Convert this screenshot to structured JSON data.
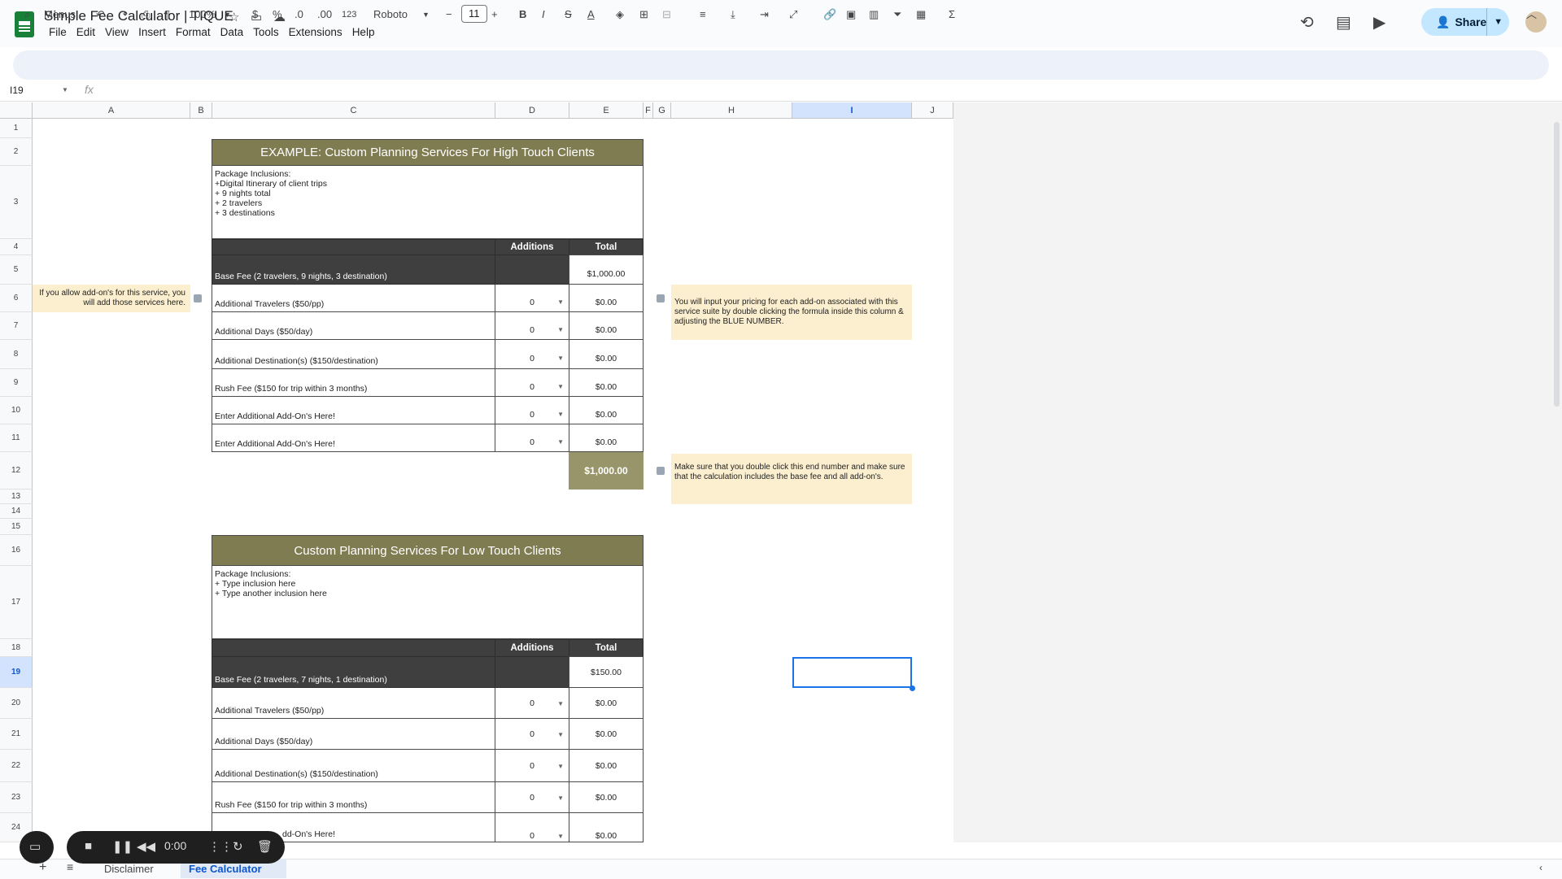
{
  "app": {
    "title": "Simple Fee Calculator | TIQUE",
    "menu": [
      "File",
      "Edit",
      "View",
      "Insert",
      "Format",
      "Data",
      "Tools",
      "Extensions",
      "Help"
    ],
    "share_label": "Share"
  },
  "toolbar": {
    "menus_label": "Menus",
    "zoom": "100%",
    "currency": "$",
    "percent": "%",
    "dec_dec": ".0",
    "inc_dec": ".00",
    "num_fmt": "123",
    "font": "Roboto",
    "font_size": "11",
    "bold": "B",
    "italic": "I",
    "strike": "S",
    "textcolor": "A",
    "sum": "Σ"
  },
  "formula_bar": {
    "cell_ref": "I19",
    "fx": "fx"
  },
  "columns": [
    "A",
    "B",
    "C",
    "D",
    "E",
    "F",
    "G",
    "H",
    "I",
    "J"
  ],
  "rows": [
    "1",
    "2",
    "3",
    "4",
    "5",
    "6",
    "7",
    "8",
    "9",
    "10",
    "11",
    "12",
    "13",
    "14",
    "15",
    "16",
    "17",
    "18",
    "19",
    "20",
    "21",
    "22",
    "23",
    "24"
  ],
  "table1": {
    "title": "EXAMPLE: Custom Planning Services For High Touch Clients",
    "inclusions": [
      "Package Inclusions:",
      "+Digital Itinerary of client trips",
      "+ 9 nights total",
      "+ 2 travelers",
      "+ 3 destinations"
    ],
    "col_additions": "Additions",
    "col_total": "Total",
    "base_label": "Base Fee (2 travelers, 9 nights,  3 destination)",
    "base_total": "$1,000.00",
    "items": [
      {
        "label": "Additional Travelers ($50/pp)",
        "qty": "0",
        "total": "$0.00"
      },
      {
        "label": "Additional Days ($50/day)",
        "qty": "0",
        "total": "$0.00"
      },
      {
        "label": "Additional Destination(s) ($150/destination)",
        "qty": "0",
        "total": "$0.00"
      },
      {
        "label": "Rush Fee ($150 for trip within 3 months)",
        "qty": "0",
        "total": "$0.00"
      },
      {
        "label": "Enter Additional Add-On's Here!",
        "qty": "0",
        "total": "$0.00"
      },
      {
        "label": "Enter Additional Add-On's Here!",
        "qty": "0",
        "total": "$0.00"
      }
    ],
    "grand_total": "$1,000.00"
  },
  "notes": {
    "left": "If you allow add-on's for this service, you will add those services here.",
    "right1": "You will input your pricing for each add-on associated with this service suite by double clicking the formula inside this column & adjusting the BLUE NUMBER.",
    "right2": "Make sure that you double click this end number and make sure that the calculation includes the base fee and all add-on's."
  },
  "table2": {
    "title": "Custom Planning Services For Low Touch Clients",
    "inclusions": [
      "Package Inclusions:",
      "+ Type inclusion here",
      "+ Type another inclusion here"
    ],
    "col_additions": "Additions",
    "col_total": "Total",
    "base_label": "Base Fee (2 travelers, 7 nights, 1 destination)",
    "base_total": "$150.00",
    "items": [
      {
        "label": "Additional Travelers ($50/pp)",
        "qty": "0",
        "total": "$0.00"
      },
      {
        "label": "Additional Days ($50/day)",
        "qty": "0",
        "total": "$0.00"
      },
      {
        "label": "Additional Destination(s) ($150/destination)",
        "qty": "0",
        "total": "$0.00"
      },
      {
        "label": "Rush Fee ($150 for trip within 3 months)",
        "qty": "0",
        "total": "$0.00"
      },
      {
        "label": "dd-On's Here!",
        "qty": "0",
        "total": "$0.00"
      }
    ]
  },
  "recorder": {
    "time": "0:00"
  },
  "sheet_tabs": [
    "Disclaimer",
    "Fee Calculator"
  ]
}
